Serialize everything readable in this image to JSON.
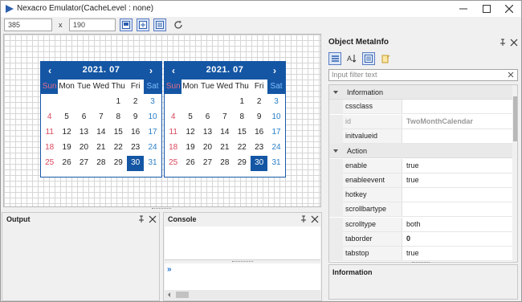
{
  "window": {
    "title": "Nexacro Emulator(CacheLevel : none)"
  },
  "toolbar": {
    "width_value": "385",
    "x_label": "x",
    "height_value": "190"
  },
  "calendars": [
    {
      "title": "2021.  07",
      "weekdays": [
        "Sun",
        "Mon",
        "Tue",
        "Wed",
        "Thu",
        "Fri",
        "Sat"
      ],
      "weeks": [
        [
          "",
          "",
          "",
          "",
          "1",
          "2",
          "3"
        ],
        [
          "4",
          "5",
          "6",
          "7",
          "8",
          "9",
          "10"
        ],
        [
          "11",
          "12",
          "13",
          "14",
          "15",
          "16",
          "17"
        ],
        [
          "18",
          "19",
          "20",
          "21",
          "22",
          "23",
          "24"
        ],
        [
          "25",
          "26",
          "27",
          "28",
          "29",
          "30",
          "31"
        ]
      ],
      "selected": "30"
    },
    {
      "title": "2021.  07",
      "weekdays": [
        "Sun",
        "Mon",
        "Tue",
        "Wed",
        "Thu",
        "Fri",
        "Sat"
      ],
      "weeks": [
        [
          "",
          "",
          "",
          "",
          "1",
          "2",
          "3"
        ],
        [
          "4",
          "5",
          "6",
          "7",
          "8",
          "9",
          "10"
        ],
        [
          "11",
          "12",
          "13",
          "14",
          "15",
          "16",
          "17"
        ],
        [
          "18",
          "19",
          "20",
          "21",
          "22",
          "23",
          "24"
        ],
        [
          "25",
          "26",
          "27",
          "28",
          "29",
          "30",
          "31"
        ]
      ],
      "selected": "30"
    }
  ],
  "panels": {
    "output": "Output",
    "console": "Console",
    "console_prompt": "»"
  },
  "meta": {
    "title": "Object MetaInfo",
    "filter_placeholder": "Input filter text",
    "groups": [
      {
        "label": "Information",
        "rows": [
          {
            "name": "cssclass",
            "value": "",
            "disabled": false
          },
          {
            "name": "id",
            "value": "TwoMonthCalendar",
            "disabled": true
          },
          {
            "name": "initvalueid",
            "value": "",
            "disabled": false
          }
        ]
      },
      {
        "label": "Action",
        "rows": [
          {
            "name": "enable",
            "value": "true",
            "disabled": false
          },
          {
            "name": "enableevent",
            "value": "true",
            "disabled": false
          },
          {
            "name": "hotkey",
            "value": "",
            "disabled": false
          },
          {
            "name": "scrollbartype",
            "value": "",
            "disabled": false
          },
          {
            "name": "scrolltype",
            "value": "both",
            "disabled": false
          },
          {
            "name": "taborder",
            "value": "0",
            "disabled": false,
            "bold": true
          },
          {
            "name": "tabstop",
            "value": "true",
            "disabled": false
          }
        ]
      }
    ],
    "info_title": "Information"
  },
  "colors": {
    "calendar_header": "#1456a4",
    "sunday": "#d9475c",
    "saturday": "#2a7fc8"
  }
}
